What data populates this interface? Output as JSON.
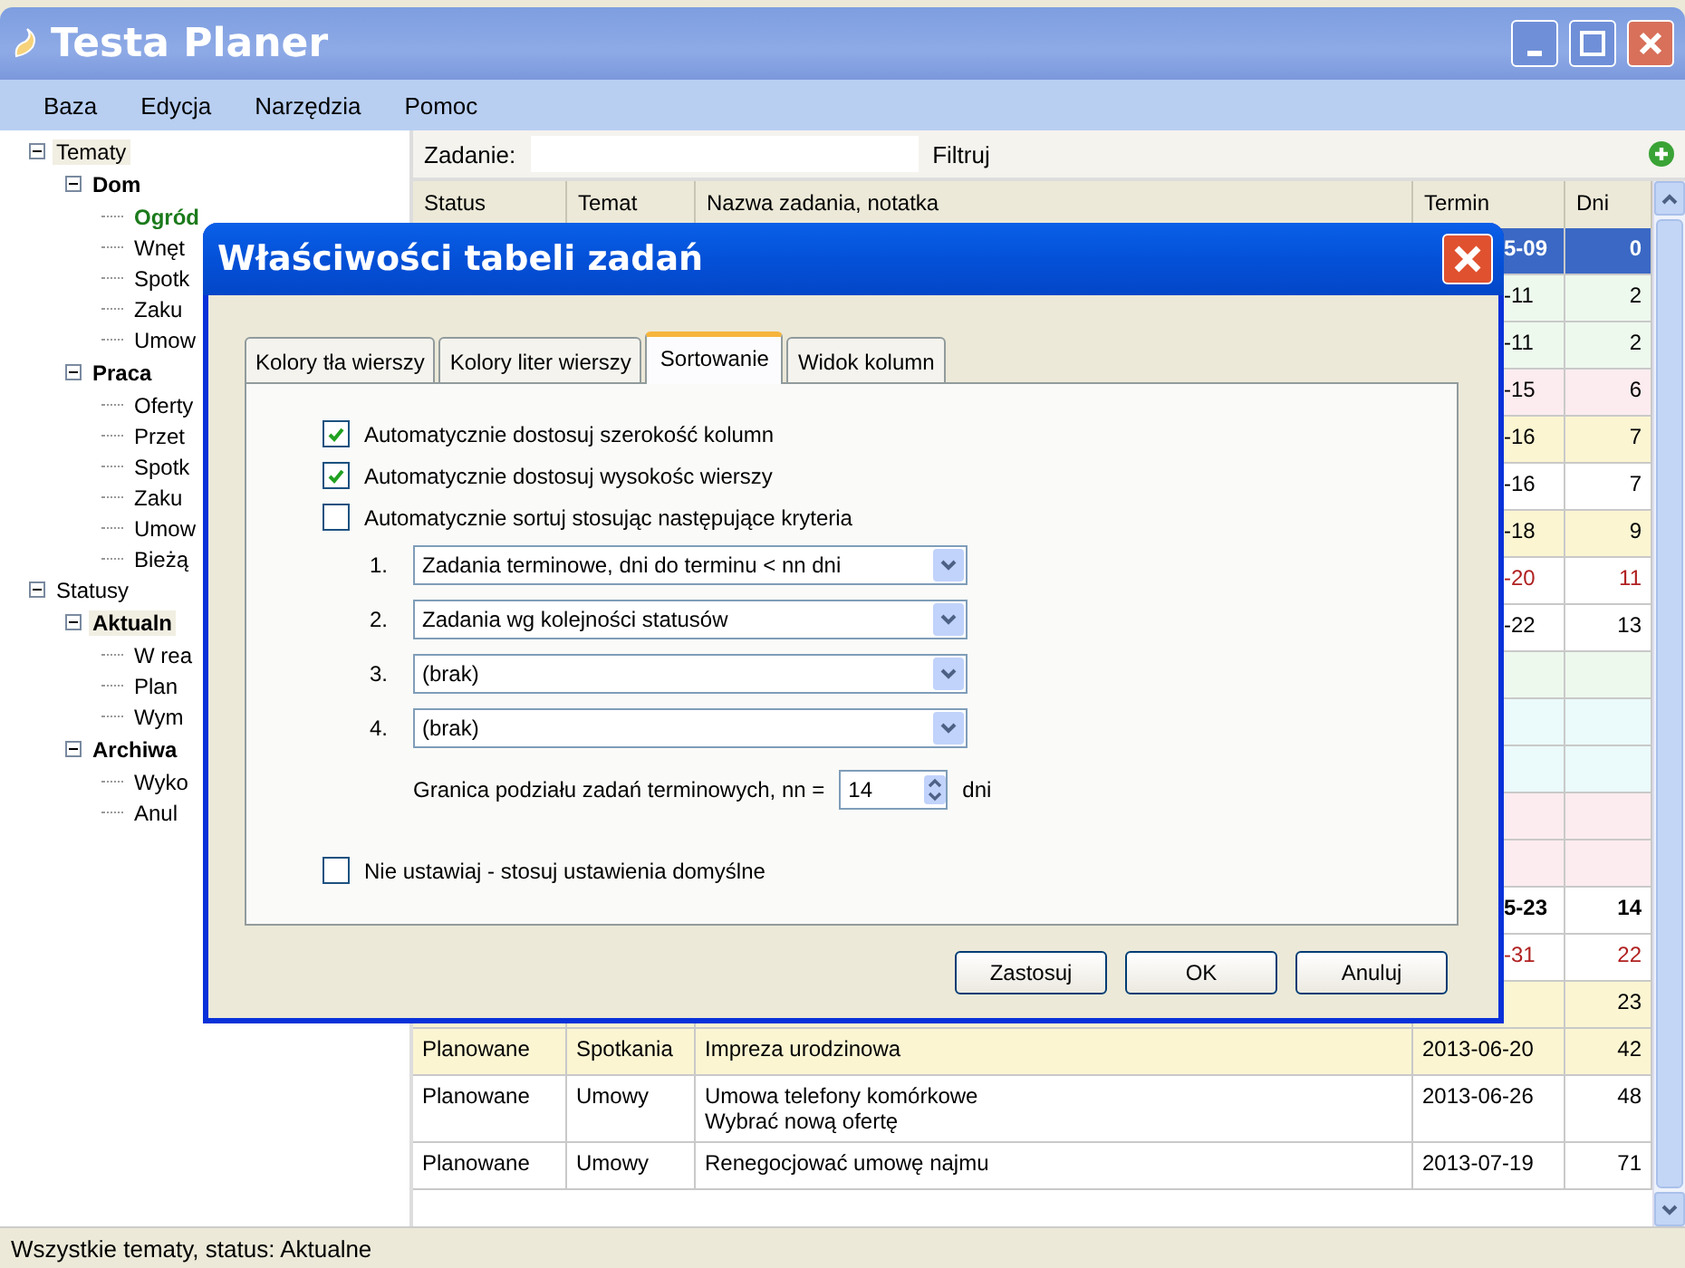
{
  "window": {
    "title": "Testa Planer"
  },
  "menu": [
    "Baza",
    "Edycja",
    "Narzędzia",
    "Pomoc"
  ],
  "tree": [
    {
      "label": "Tematy",
      "selected": true,
      "children": [
        {
          "label": "Dom",
          "selected": false,
          "children": [
            {
              "label": "Ogród",
              "selected": true
            },
            {
              "label": "Wnęt",
              "selected": false
            },
            {
              "label": "Spotk",
              "selected": false
            },
            {
              "label": "Zaku",
              "selected": false
            },
            {
              "label": "Umow",
              "selected": false
            }
          ]
        },
        {
          "label": "Praca",
          "selected": false,
          "children": [
            {
              "label": "Oferty",
              "selected": false
            },
            {
              "label": "Przet",
              "selected": false
            },
            {
              "label": "Spotk",
              "selected": false
            },
            {
              "label": "Zaku",
              "selected": false
            },
            {
              "label": "Umow",
              "selected": false
            },
            {
              "label": "Bieżą",
              "selected": false
            }
          ]
        }
      ]
    },
    {
      "label": "Statusy",
      "selected": false,
      "children": [
        {
          "label": "Aktualn",
          "selected": true,
          "children": [
            {
              "label": "W rea",
              "selected": false
            },
            {
              "label": "Plan",
              "selected": false
            },
            {
              "label": "Wym",
              "selected": false
            }
          ]
        },
        {
          "label": "Archiwa",
          "selected": false,
          "children": [
            {
              "label": "Wyko",
              "selected": false
            },
            {
              "label": "Anul",
              "selected": false
            }
          ]
        }
      ]
    }
  ],
  "toolbar": {
    "label": "Zadanie:",
    "filter": "Filtruj"
  },
  "table": {
    "columns": [
      "Status",
      "Temat",
      "Nazwa zadania, notatka",
      "Termin",
      "Dni"
    ],
    "rows": [
      {
        "due": "5-09",
        "days": "0",
        "selected": true,
        "bold": true
      },
      {
        "due": "-11",
        "days": "2",
        "color": "#eef9ee",
        "selected": false,
        "alert": false,
        "bold": false
      },
      {
        "due": "-11",
        "days": "2",
        "color": "#eef9ee",
        "selected": false,
        "alert": false,
        "bold": false
      },
      {
        "due": "-15",
        "days": "6",
        "color": "#fdecef",
        "selected": false,
        "alert": false,
        "bold": false
      },
      {
        "due": "-16",
        "days": "7",
        "color": "#fbf5d2",
        "selected": false,
        "alert": false,
        "bold": false
      },
      {
        "due": "-16",
        "days": "7",
        "color": "#ffffff",
        "selected": false,
        "alert": false,
        "bold": false
      },
      {
        "due": "-18",
        "days": "9",
        "color": "#fbf5d2",
        "selected": false,
        "alert": false,
        "bold": false
      },
      {
        "due": "-20",
        "days": "11",
        "color": "#ffffff",
        "selected": false,
        "alert": true,
        "bold": false
      },
      {
        "due": "-22",
        "days": "13",
        "color": "#ffffff",
        "selected": false,
        "alert": false,
        "bold": false
      },
      {
        "color": "#eef9ee",
        "selected": false
      },
      {
        "color": "#ebfafa",
        "selected": false
      },
      {
        "color": "#ebfafa",
        "selected": false
      },
      {
        "color": "#fdecef",
        "selected": false
      },
      {
        "color": "#fdecef",
        "selected": false
      },
      {
        "due": "5-23",
        "days": "14",
        "color": "#ffffff",
        "selected": false,
        "alert": false,
        "bold": true
      },
      {
        "due": "-31",
        "days": "22",
        "color": "#ffffff",
        "selected": false,
        "alert": true,
        "bold": false
      },
      {
        "days": "23",
        "color": "#fbf5d2",
        "selected": false,
        "alert": false,
        "bold": false
      },
      {
        "status": "Planowane",
        "topic": "Spotkania",
        "name": "Impreza urodzinowa",
        "due": "2013-06-20",
        "days": "42",
        "color": "#fbf5d2",
        "selected": false,
        "alert": false,
        "bold": false
      },
      {
        "status": "Planowane",
        "topic": "Umowy",
        "name": "Umowa telefony komórkowe",
        "note": "Wybrać nową ofertę",
        "due": "2013-06-26",
        "days": "48",
        "color": "#ffffff",
        "selected": false,
        "alert": false,
        "bold": false
      },
      {
        "status": "Planowane",
        "topic": "Umowy",
        "name": "Renegocjować umowę najmu",
        "due": "2013-07-19",
        "days": "71",
        "color": "#ffffff",
        "selected": false,
        "alert": false,
        "bold": false
      }
    ]
  },
  "dialog": {
    "title": "Właściwości tabeli zadań",
    "tabs": [
      {
        "label": "Kolory tła wierszy",
        "selected": false
      },
      {
        "label": "Kolory liter wierszy",
        "selected": false
      },
      {
        "label": "Sortowanie",
        "selected": true
      },
      {
        "label": "Widok kolumn",
        "selected": false
      }
    ],
    "options": [
      {
        "label": "Automatycznie dostosuj szerokość kolumn",
        "checked": true
      },
      {
        "label": "Automatycznie dostosuj wysokośc wierszy",
        "checked": true
      },
      {
        "label": "Automatycznie sortuj stosując następujące kryteria",
        "checked": false
      }
    ],
    "criteria": [
      {
        "number": "1.",
        "value": "Zadania terminowe, dni do terminu < nn dni"
      },
      {
        "number": "2.",
        "value": "Zadania wg kolejności statusów"
      },
      {
        "number": "3.",
        "value": "(brak)"
      },
      {
        "number": "4.",
        "value": "(brak)"
      }
    ],
    "threshold": {
      "label": "Granica podziału zadań terminowych, nn =",
      "value": "14",
      "unit": "dni"
    },
    "default_option": {
      "label": "Nie ustawiaj - stosuj ustawienia domyślne",
      "checked": false
    },
    "buttons": [
      "Zastosuj",
      "OK",
      "Anuluj"
    ]
  },
  "status_bar": "Wszystkie tematy, status: Aktualne"
}
